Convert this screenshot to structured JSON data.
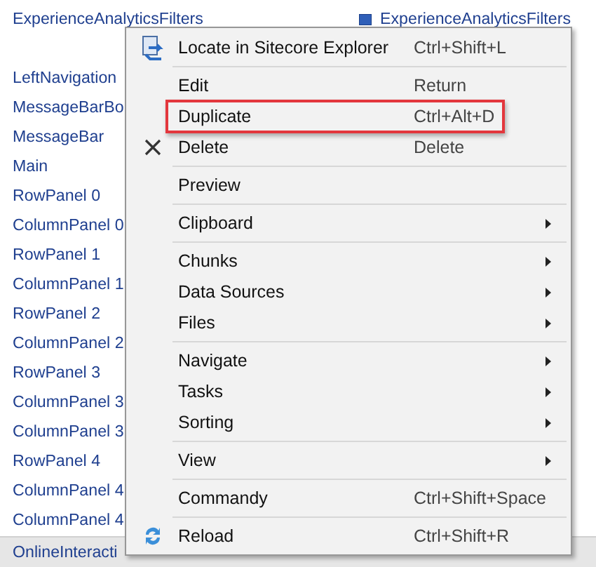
{
  "tree_left": {
    "header": "ExperienceAnalyticsFilters",
    "items": [
      "LeftNavigation",
      "MessageBarBo",
      "MessageBar",
      "Main",
      "RowPanel 0",
      "ColumnPanel 0",
      "RowPanel 1",
      "ColumnPanel 1",
      "RowPanel 2",
      "ColumnPanel 2",
      "RowPanel 3",
      "ColumnPanel 3",
      "ColumnPanel 3",
      "RowPanel 4",
      "ColumnPanel 4",
      "ColumnPanel 4"
    ],
    "footer": "OnlineInteracti"
  },
  "tree_right": {
    "header": "ExperienceAnalyticsFilters"
  },
  "context_menu": {
    "groups": [
      [
        {
          "label": "Locate in Sitecore Explorer",
          "shortcut": "Ctrl+Shift+L",
          "kind": "locate",
          "submenu": false,
          "highlighted": false
        }
      ],
      [
        {
          "label": "Edit",
          "shortcut": "Return",
          "submenu": false,
          "highlighted": false
        },
        {
          "label": "Duplicate",
          "shortcut": "Ctrl+Alt+D",
          "submenu": false,
          "highlighted": true
        },
        {
          "label": "Delete",
          "shortcut": "Delete",
          "kind": "delete",
          "submenu": false,
          "highlighted": false
        }
      ],
      [
        {
          "label": "Preview",
          "submenu": false,
          "highlighted": false
        }
      ],
      [
        {
          "label": "Clipboard",
          "submenu": true,
          "highlighted": false
        }
      ],
      [
        {
          "label": "Chunks",
          "submenu": true,
          "highlighted": false
        },
        {
          "label": "Data Sources",
          "submenu": true,
          "highlighted": false
        },
        {
          "label": "Files",
          "submenu": true,
          "highlighted": false
        }
      ],
      [
        {
          "label": "Navigate",
          "submenu": true,
          "highlighted": false
        },
        {
          "label": "Tasks",
          "submenu": true,
          "highlighted": false
        },
        {
          "label": "Sorting",
          "submenu": true,
          "highlighted": false
        }
      ],
      [
        {
          "label": "View",
          "submenu": true,
          "highlighted": false
        }
      ],
      [
        {
          "label": "Commandy",
          "shortcut": "Ctrl+Shift+Space",
          "submenu": false,
          "highlighted": false
        }
      ],
      [
        {
          "label": "Reload",
          "shortcut": "Ctrl+Shift+R",
          "kind": "reload",
          "submenu": false,
          "highlighted": false
        }
      ]
    ]
  }
}
